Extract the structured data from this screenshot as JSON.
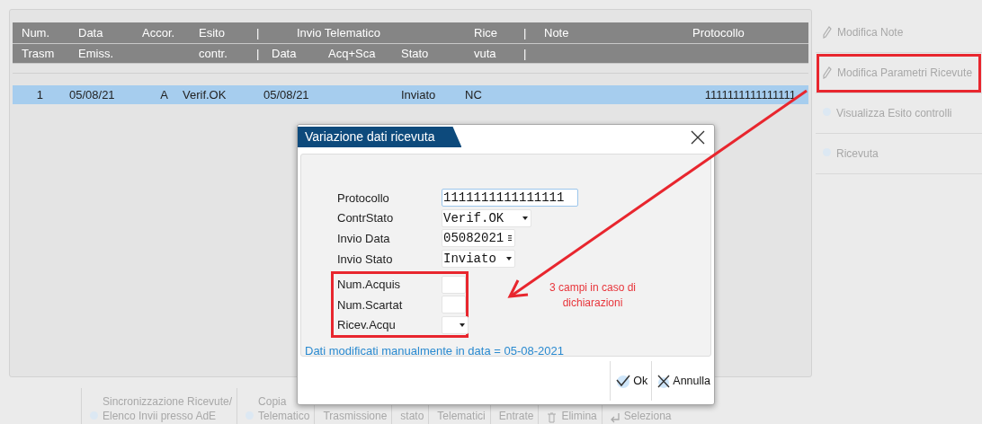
{
  "table": {
    "header_rows": [
      [
        "Num.",
        "Data",
        "Accor.",
        "Esito",
        "|",
        "Invio Telematico",
        "Rice",
        "|",
        "Note",
        "Protocollo"
      ],
      [
        "Trasm",
        "Emiss.",
        "",
        "contr.",
        "|",
        "Data",
        "Acq+Sca",
        "Stato",
        "vuta",
        "|"
      ]
    ],
    "rows": [
      {
        "selected": true,
        "cells": [
          "1",
          "05/08/21",
          "A",
          "Verif.OK",
          "05/08/21",
          "Inviato",
          "NC",
          "1111111111111111"
        ]
      }
    ]
  },
  "side_actions": [
    {
      "label": "Modifica Note",
      "disabled": true,
      "highlighted": false
    },
    {
      "label": "Modifica Parametri Ricevute",
      "disabled": true,
      "highlighted": true
    },
    {
      "label": "Visualizza Esito controlli",
      "disabled": true,
      "highlighted": false
    },
    {
      "label": "Ricevuta",
      "disabled": true,
      "highlighted": false
    }
  ],
  "toolbar": [
    {
      "lines": [
        "Sincronizzazione Ricevute/",
        "Elenco Invii presso AdE"
      ],
      "disabled": true
    },
    {
      "lines": [
        "Copia",
        "Telematico"
      ],
      "disabled": true
    },
    {
      "lines": [
        "Trasmissione"
      ],
      "disabled": true
    },
    {
      "lines": [
        "stato"
      ],
      "disabled": true
    },
    {
      "lines": [
        "Telematici"
      ],
      "disabled": true
    },
    {
      "lines": [
        "Entrate"
      ],
      "disabled": true
    },
    {
      "lines": [
        "Elimina"
      ],
      "disabled": true
    },
    {
      "lines": [
        "Seleziona"
      ],
      "disabled": true
    }
  ],
  "dialog": {
    "title": "Variazione dati ricevuta",
    "fields": [
      {
        "label": "Protocollo",
        "kind": "text",
        "value": "1111111111111111",
        "focused": true,
        "highlighted": false
      },
      {
        "label": "ContrStato",
        "kind": "select",
        "value": "Verif.OK",
        "focused": false,
        "highlighted": false
      },
      {
        "label": "Invio Data",
        "kind": "date",
        "value": "05082021",
        "focused": false,
        "highlighted": false
      },
      {
        "label": "Invio Stato",
        "kind": "select",
        "value": "Inviato",
        "focused": false,
        "highlighted": false
      },
      {
        "label": "Num.Acquis",
        "kind": "text",
        "focused": false,
        "highlighted": true
      },
      {
        "label": "Num.Scartat",
        "kind": "text",
        "focused": false,
        "highlighted": true
      },
      {
        "label": "Ricev.Acqu",
        "kind": "select",
        "focused": false,
        "highlighted": true
      }
    ],
    "message": "Dati modificati manualmente in data = 05-08-2021",
    "buttons": [
      "Ok",
      "Annulla"
    ]
  },
  "annotation": {
    "text": "3 campi in caso di dichiarazioni"
  }
}
